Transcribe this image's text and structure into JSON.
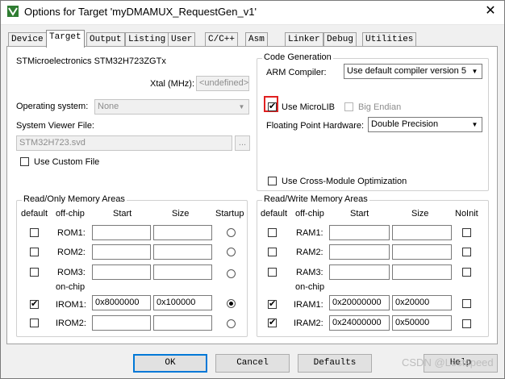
{
  "window": {
    "title": "Options for Target 'myDMAMUX_RequestGen_v1'",
    "close_glyph": "✕"
  },
  "tabs": [
    {
      "label": "Device"
    },
    {
      "label": "Target",
      "active": true
    },
    {
      "label": "Output"
    },
    {
      "label": "Listing"
    },
    {
      "label": "User"
    },
    {
      "label": "C/C++"
    },
    {
      "label": "Asm"
    },
    {
      "label": "Linker"
    },
    {
      "label": "Debug"
    },
    {
      "label": "Utilities"
    }
  ],
  "device": {
    "name": "STMicroelectronics STM32H723ZGTx",
    "xtal_label": "Xtal (MHz):",
    "xtal_value": "<undefined>",
    "os_label": "Operating system:",
    "os_value": "None",
    "svd_label": "System Viewer File:",
    "svd_value": "STM32H723.svd",
    "browse_label": "...",
    "custom_file_label": "Use Custom File",
    "custom_file_checked": false
  },
  "code_generation": {
    "title": "Code Generation",
    "arm_compiler_label": "ARM Compiler:",
    "arm_compiler_value": "Use default compiler version 5",
    "microlib_label": "Use MicroLIB",
    "microlib_checked": true,
    "big_endian_label": "Big Endian",
    "big_endian_checked": false,
    "fph_label": "Floating Point Hardware:",
    "fph_value": "Double Precision",
    "cross_module_label": "Use Cross-Module Optimization",
    "cross_module_checked": false
  },
  "rom_areas": {
    "title": "Read/Only Memory Areas",
    "headers": {
      "default": "default",
      "offchip": "off-chip",
      "start": "Start",
      "size": "Size",
      "last": "Startup"
    },
    "onchip_label": "on-chip",
    "rows": [
      {
        "name": "ROM1:",
        "default": false,
        "start": "",
        "size": "",
        "startup": false
      },
      {
        "name": "ROM2:",
        "default": false,
        "start": "",
        "size": "",
        "startup": false
      },
      {
        "name": "ROM3:",
        "default": false,
        "start": "",
        "size": "",
        "startup": false
      },
      {
        "name": "IROM1:",
        "default": true,
        "start": "0x8000000",
        "size": "0x100000",
        "startup": true
      },
      {
        "name": "IROM2:",
        "default": false,
        "start": "",
        "size": "",
        "startup": false
      }
    ]
  },
  "ram_areas": {
    "title": "Read/Write Memory Areas",
    "headers": {
      "default": "default",
      "offchip": "off-chip",
      "start": "Start",
      "size": "Size",
      "last": "NoInit"
    },
    "onchip_label": "on-chip",
    "rows": [
      {
        "name": "RAM1:",
        "default": false,
        "start": "",
        "size": "",
        "noinit": false
      },
      {
        "name": "RAM2:",
        "default": false,
        "start": "",
        "size": "",
        "noinit": false
      },
      {
        "name": "RAM3:",
        "default": false,
        "start": "",
        "size": "",
        "noinit": false
      },
      {
        "name": "IRAM1:",
        "default": true,
        "start": "0x20000000",
        "size": "0x20000",
        "noinit": false
      },
      {
        "name": "IRAM2:",
        "default": true,
        "start": "0x24000000",
        "size": "0x50000",
        "noinit": false
      }
    ]
  },
  "buttons": {
    "ok": "OK",
    "cancel": "Cancel",
    "defaults": "Defaults",
    "help": "Help"
  },
  "watermark": "CSDN @Lostspeed",
  "check_glyph": "✔",
  "arrow_glyph": "▼"
}
